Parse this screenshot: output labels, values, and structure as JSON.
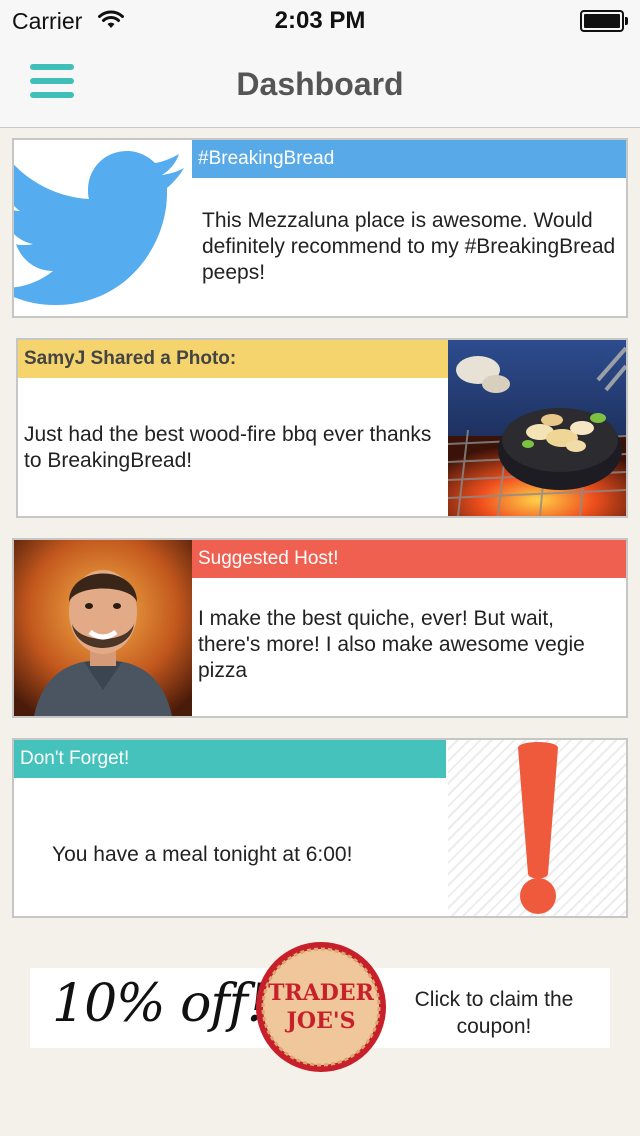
{
  "status_bar": {
    "carrier": "Carrier",
    "time": "2:03 PM"
  },
  "nav": {
    "title": "Dashboard",
    "menu_icon": "hamburger-menu-icon"
  },
  "cards": [
    {
      "type": "twitter",
      "header": "#BreakingBread",
      "body": "This Mezzaluna place is awesome. Would definitely recommend to my #BreakingBread peeps!",
      "icon": "twitter-bird-icon",
      "accent": "#58a9e8"
    },
    {
      "type": "photo",
      "header": "SamyJ Shared a Photo:",
      "body": "Just had the best wood-fire bbq ever thanks to BreakingBread!",
      "accent": "#f5d46d"
    },
    {
      "type": "host",
      "header": "Suggested Host!",
      "body": "I make the best quiche, ever! But wait, there's more! I also make awesome vegie pizza",
      "accent": "#f06050"
    },
    {
      "type": "reminder",
      "header": "Don't Forget!",
      "body": "You have a meal tonight at 6:00!",
      "icon": "exclamation-icon",
      "accent": "#45c2bb"
    }
  ],
  "coupon": {
    "offer": "10% off!",
    "brand_line1": "TRADER",
    "brand_line2": "JOE'S",
    "cta": "Click to claim the coupon!"
  }
}
